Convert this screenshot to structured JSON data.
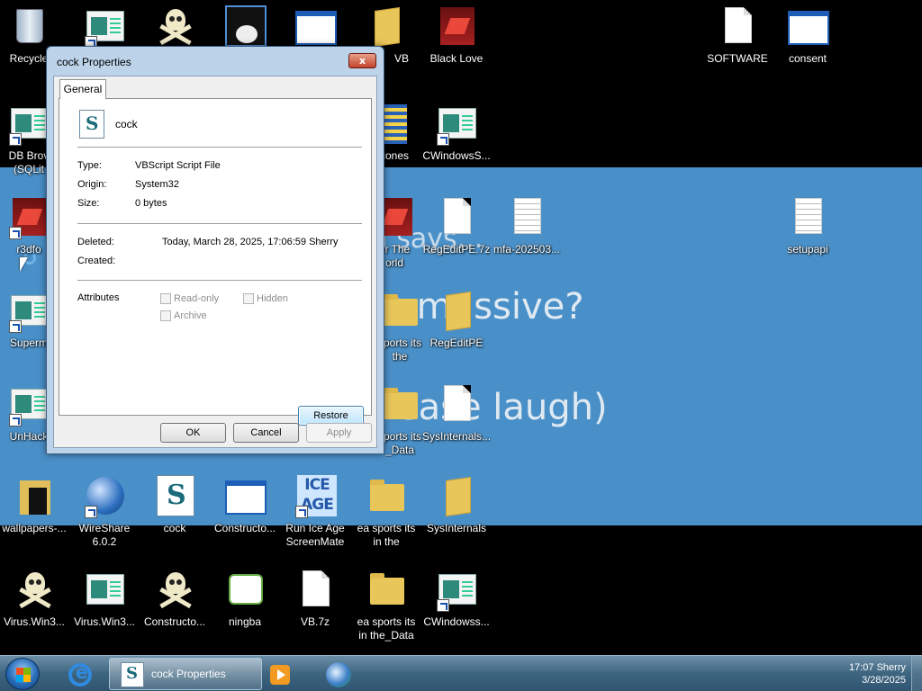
{
  "wallpaper": {
    "text_lines": [
      "nja says...",
      "is massive?",
      "ease laugh)"
    ]
  },
  "desktop_icons": [
    {
      "label": "Recycle",
      "icon": "recycle-bin-icon"
    },
    {
      "label": "",
      "icon": "app-window-icon"
    },
    {
      "label": "",
      "icon": "skull-icon"
    },
    {
      "label": "",
      "icon": "cat-image-icon"
    },
    {
      "label": "",
      "icon": "window-file-icon"
    },
    {
      "label": "VB",
      "icon": "folder-open-icon"
    },
    {
      "label": "Black Love",
      "icon": "red-cube-icon"
    },
    {
      "label": "SOFTWARE",
      "icon": "document-icon"
    },
    {
      "label": "consent",
      "icon": "window-icon"
    },
    {
      "label": "DB Brov",
      "label2": "(SQLit",
      "icon": "app-window-icon"
    },
    {
      "label": "cones",
      "icon": "archive-icon"
    },
    {
      "label": "CWindowsS...",
      "icon": "app-window-icon"
    },
    {
      "label": "r3dfo",
      "icon": "red-cube-icon"
    },
    {
      "label": "or The",
      "label2": "orld",
      "icon": "red-cube-icon"
    },
    {
      "label": "RegEditPE.7z",
      "icon": "document-icon"
    },
    {
      "label": "mfa-202503...",
      "icon": "text-document-icon"
    },
    {
      "label": "setupapi",
      "icon": "text-document-icon"
    },
    {
      "label": "Superm",
      "icon": "app-window-icon"
    },
    {
      "label": "sports its",
      "label2": "the",
      "icon": "folder-icon"
    },
    {
      "label": "RegEditPE",
      "icon": "folder-open-icon"
    },
    {
      "label": "UnHack",
      "icon": "app-window-icon"
    },
    {
      "label": "sports its",
      "label2": "_Data",
      "icon": "folder-icon"
    },
    {
      "label": "SysInternals...",
      "icon": "document-icon"
    },
    {
      "label": "wallpapers-...",
      "icon": "folder-dark-icon"
    },
    {
      "label": "WireShare",
      "label2": "6.0.2",
      "icon": "globe-icon"
    },
    {
      "label": "cock",
      "icon": "vbscript-icon"
    },
    {
      "label": "Constructo...",
      "icon": "window-file-icon"
    },
    {
      "label": "Run Ice Age",
      "label2": "ScreenMate",
      "icon": "ice-age-icon"
    },
    {
      "label": "ea sports its",
      "label2": "in the",
      "icon": "folder-icon"
    },
    {
      "label": "SysInternals",
      "icon": "folder-open-icon"
    },
    {
      "label": "Virus.Win3...",
      "icon": "skull-icon"
    },
    {
      "label": "Virus.Win3...",
      "icon": "app-window-icon"
    },
    {
      "label": "Constructo...",
      "icon": "skull-icon"
    },
    {
      "label": "ningba",
      "icon": "handshake-icon"
    },
    {
      "label": "VB.7z",
      "icon": "document-icon"
    },
    {
      "label": "ea sports its",
      "label2": "in the_Data",
      "icon": "folder-icon"
    },
    {
      "label": "CWindowss...",
      "icon": "app-window-icon"
    }
  ],
  "dialog": {
    "title": "cock Properties",
    "close_glyph": "x",
    "tab_label": "General",
    "file_name": "cock",
    "type_label": "Type:",
    "type_value": "VBScript Script File",
    "origin_label": "Origin:",
    "origin_value": "System32",
    "size_label": "Size:",
    "size_value": "0 bytes",
    "deleted_label": "Deleted:",
    "deleted_value": "Today, March 28, 2025, 17:06:59 Sherry",
    "created_label": "Created:",
    "attributes_label": "Attributes",
    "readonly_label": "Read-only",
    "hidden_label": "Hidden",
    "archive_label": "Archive",
    "restore_label": "Restore",
    "ok_label": "OK",
    "cancel_label": "Cancel",
    "apply_label": "Apply"
  },
  "taskbar": {
    "task_label": "cock Properties",
    "clock_time": "17:07 Sherry",
    "clock_date": "3/28/2025"
  }
}
